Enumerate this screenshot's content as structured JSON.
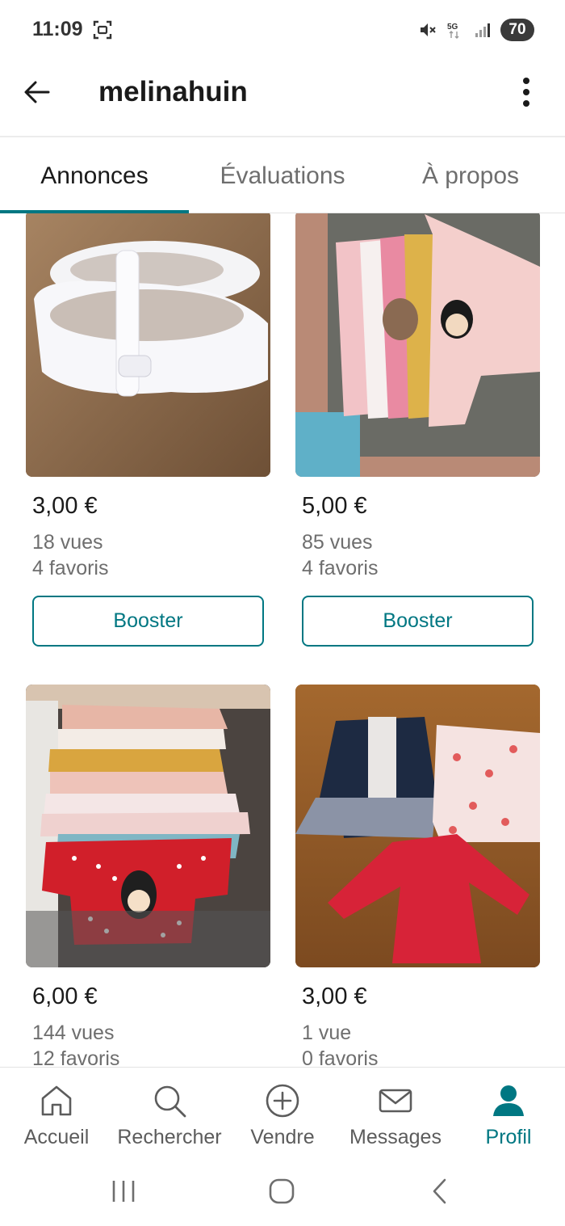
{
  "status_bar": {
    "time": "11:09",
    "network": "5G",
    "battery": "70",
    "icons": [
      "screenshot-icon",
      "mute-icon",
      "5g-icon",
      "signal-icon",
      "battery-icon"
    ]
  },
  "app_bar": {
    "title": "melinahuin",
    "icons": [
      "back-arrow-icon",
      "more-vertical-icon"
    ]
  },
  "tabs": [
    {
      "label": "Annonces",
      "active": true
    },
    {
      "label": "Évaluations",
      "active": false
    },
    {
      "label": "À propos",
      "active": false
    }
  ],
  "listings": [
    {
      "price": "3,00 €",
      "views": "18 vues",
      "favorites": "4 favoris",
      "boost_label": "Booster",
      "photo": "white patent baby shoes"
    },
    {
      "price": "5,00 €",
      "views": "85 vues",
      "favorites": "4 favoris",
      "boost_label": "Booster",
      "photo": "pink baby bodysuits"
    },
    {
      "price": "6,00 €",
      "views": "144 vues",
      "favorites": "12 favoris",
      "photo": "pile of baby tops"
    },
    {
      "price": "3,00 €",
      "views": "1 vue",
      "favorites": "0 favoris",
      "photo": "girl dress, floral top, red sweater"
    }
  ],
  "bottom_nav": [
    {
      "label": "Accueil",
      "icon": "home-icon",
      "active": false
    },
    {
      "label": "Rechercher",
      "icon": "search-icon",
      "active": false
    },
    {
      "label": "Vendre",
      "icon": "add-circle-icon",
      "active": false
    },
    {
      "label": "Messages",
      "icon": "mail-icon",
      "active": false
    },
    {
      "label": "Profil",
      "icon": "profile-icon",
      "active": true
    }
  ],
  "system_nav": [
    "recents-icon",
    "home-circle-icon",
    "back-chevron-icon"
  ],
  "colors": {
    "accent": "#007782",
    "text": "#1a1a1a",
    "muted": "#6e6e6e"
  }
}
